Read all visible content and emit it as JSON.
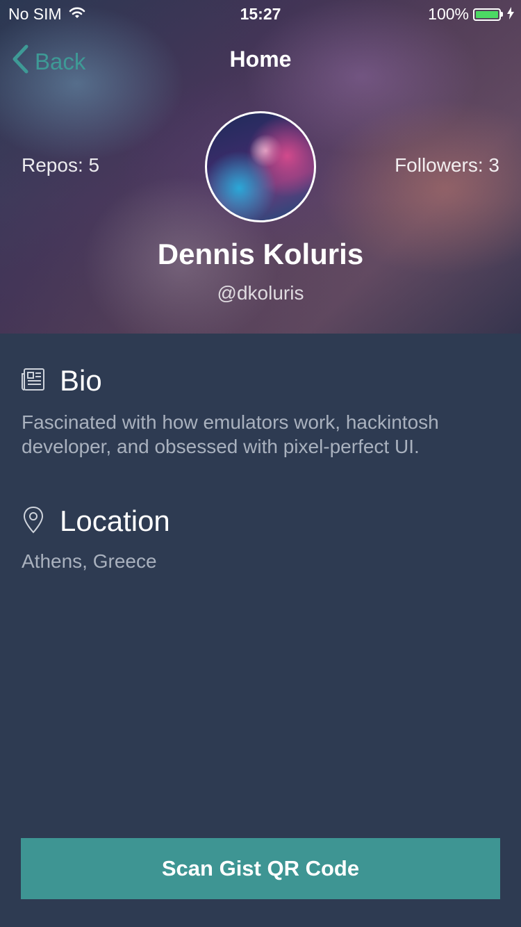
{
  "status_bar": {
    "carrier": "No SIM",
    "time": "15:27",
    "battery": "100%"
  },
  "nav": {
    "back_label": "Back",
    "title": "Home"
  },
  "profile": {
    "repos": "Repos: 5",
    "followers": "Followers: 3",
    "name": "Dennis Koluris",
    "handle": "@dkoluris"
  },
  "bio": {
    "title": "Bio",
    "text": "Fascinated with how emulators work, hackintosh developer, and obsessed with pixel-perfect UI."
  },
  "location": {
    "title": "Location",
    "text": "Athens, Greece"
  },
  "action": {
    "scan_label": "Scan Gist QR Code"
  },
  "colors": {
    "accent": "#3e9593",
    "background": "#2e3b52",
    "muted_text": "#a9b1be"
  },
  "icons": {
    "bio": "newspaper-icon",
    "location": "location-pin-icon",
    "back": "chevron-left-icon",
    "wifi": "wifi-icon",
    "battery": "battery-icon",
    "charging": "bolt-icon"
  }
}
